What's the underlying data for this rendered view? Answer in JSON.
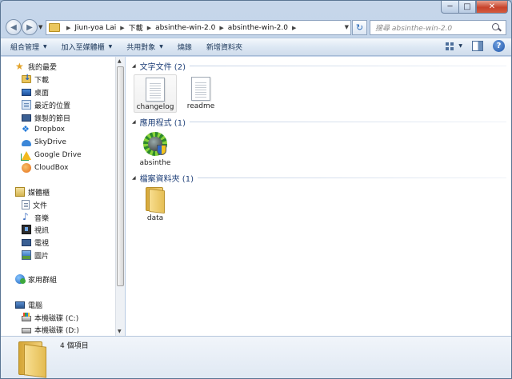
{
  "window": {
    "caption": {
      "minimize": "─",
      "maximize": "□",
      "close": "✕"
    }
  },
  "address": {
    "crumbs": [
      "Jiun-yoa Lai",
      "下載",
      "absinthe-win-2.0",
      "absinthe-win-2.0"
    ],
    "search_placeholder": "搜尋 absinthe-win-2.0"
  },
  "toolbar": {
    "organize": "組合管理",
    "add_to_library": "加入至媒體櫃",
    "share_with": "共用對象",
    "burn": "燒錄",
    "new_folder": "新增資料夾"
  },
  "navpane": {
    "favorites": {
      "label": "我的最愛",
      "items": [
        "下載",
        "桌面",
        "最近的位置",
        "錄製的節目",
        "Dropbox",
        "SkyDrive",
        "Google Drive",
        "CloudBox"
      ]
    },
    "libraries": {
      "label": "媒體櫃",
      "items": [
        "文件",
        "音樂",
        "視訊",
        "電視",
        "圖片"
      ]
    },
    "homegroup": "家用群組",
    "computer": {
      "label": "電腦",
      "items": [
        "本機磁碟 (C:)",
        "本機磁碟 (D:)"
      ]
    }
  },
  "content": {
    "groups": [
      {
        "name": "文字文件 (2)",
        "items": [
          "changelog",
          "readme"
        ]
      },
      {
        "name": "應用程式 (1)",
        "items": [
          "absinthe"
        ]
      },
      {
        "name": "檔案資料夾 (1)",
        "items": [
          "data"
        ]
      }
    ]
  },
  "details": {
    "count": "4 個項目"
  },
  "colors": {
    "accent": "#1e3f78",
    "toolbar_text": "#1e395b"
  }
}
